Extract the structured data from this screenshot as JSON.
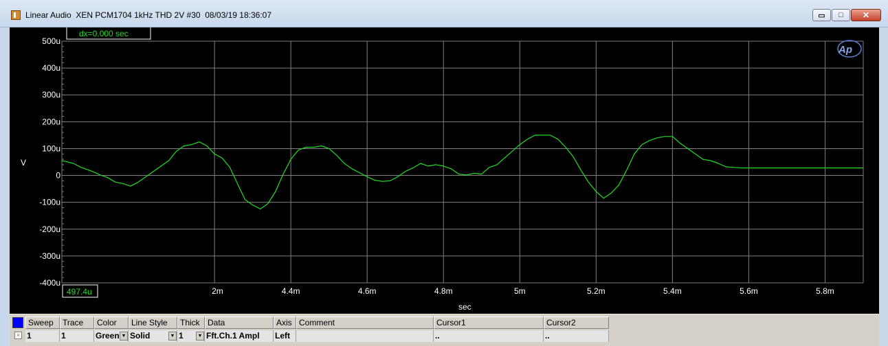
{
  "window": {
    "title": "Linear Audio  XEN PCM1704 1kHz THD 2V #30  08/03/19 18:36:07",
    "min_glyph": "▭",
    "max_glyph": "□",
    "close_glyph": "✕"
  },
  "readouts": {
    "dx": "dx=0.000   sec",
    "x_start": "497.4u"
  },
  "logo_text": "Ap",
  "chart_data": {
    "type": "line",
    "xlabel": "sec",
    "ylabel": "V",
    "xlim": [
      0.0038,
      0.0059
    ],
    "ylim": [
      -0.0004,
      0.0005
    ],
    "x_ticks": [
      {
        "value": 0.0042,
        "label": "2m"
      },
      {
        "value": 0.0044,
        "label": "4.4m"
      },
      {
        "value": 0.0046,
        "label": "4.6m"
      },
      {
        "value": 0.0048,
        "label": "4.8m"
      },
      {
        "value": 0.005,
        "label": "5m"
      },
      {
        "value": 0.0052,
        "label": "5.2m"
      },
      {
        "value": 0.0054,
        "label": "5.4m"
      },
      {
        "value": 0.0056,
        "label": "5.6m"
      },
      {
        "value": 0.0058,
        "label": "5.8m"
      }
    ],
    "y_ticks": [
      {
        "value": 0.0005,
        "label": "500u"
      },
      {
        "value": 0.0004,
        "label": "400u"
      },
      {
        "value": 0.0003,
        "label": "300u"
      },
      {
        "value": 0.0002,
        "label": "200u"
      },
      {
        "value": 0.0001,
        "label": "100u"
      },
      {
        "value": 0,
        "label": "0"
      },
      {
        "value": -0.0001,
        "label": "-100u"
      },
      {
        "value": -0.0002,
        "label": "-200u"
      },
      {
        "value": -0.0003,
        "label": "-300u"
      },
      {
        "value": -0.0004,
        "label": "-400u"
      }
    ],
    "grid": true,
    "colors": {
      "background": "#000000",
      "grid": "#808080",
      "trace": "#22dd22",
      "text": "#ffffff",
      "readout": "#22dd22"
    },
    "series": [
      {
        "x": [
          0.0038,
          0.00381,
          0.00383,
          0.00385,
          0.00388,
          0.0039,
          0.00392,
          0.00394,
          0.00396,
          0.00398,
          0.004,
          0.00402,
          0.00405,
          0.00408,
          0.0041,
          0.00412,
          0.00414,
          0.00416,
          0.00418,
          0.0042,
          0.00422,
          0.00424,
          0.00426,
          0.00428,
          0.0043,
          0.00432,
          0.00434,
          0.00436,
          0.00438,
          0.0044,
          0.00442,
          0.00444,
          0.00446,
          0.00448,
          0.0045,
          0.00452,
          0.00454,
          0.00456,
          0.00458,
          0.0046,
          0.00462,
          0.00464,
          0.00466,
          0.00468,
          0.0047,
          0.00472,
          0.00474,
          0.00476,
          0.00478,
          0.0048,
          0.00482,
          0.00484,
          0.00486,
          0.00488,
          0.0049,
          0.00492,
          0.00494,
          0.00496,
          0.00498,
          0.005,
          0.00502,
          0.00504,
          0.00506,
          0.00508,
          0.0051,
          0.00512,
          0.00514,
          0.00516,
          0.00518,
          0.0052,
          0.00522,
          0.00524,
          0.00526,
          0.00528,
          0.0053,
          0.00532,
          0.00534,
          0.00536,
          0.00538,
          0.0054,
          0.00542,
          0.00544,
          0.00546,
          0.00548,
          0.0055,
          0.00552,
          0.00554,
          0.00556,
          0.00558,
          0.0056,
          0.00562,
          0.00564,
          0.00566,
          0.00568,
          0.0057,
          0.00572,
          0.00574,
          0.00576,
          0.00578,
          0.0058,
          0.00582,
          0.00584,
          0.00586,
          0.00588,
          0.0059
        ],
        "y": [
          5.5e-05,
          5.2e-05,
          4.5e-05,
          3e-05,
          1.5e-05,
          2e-06,
          -8e-06,
          -2.5e-05,
          -3e-05,
          -4e-05,
          -2.5e-05,
          -5e-06,
          2.5e-05,
          5.5e-05,
          9e-05,
          0.00011,
          0.000115,
          0.000125,
          0.00011,
          8e-05,
          6.5e-05,
          3e-05,
          -3e-05,
          -9e-05,
          -0.00011,
          -0.000125,
          -0.000105,
          -6e-05,
          5e-06,
          6e-05,
          9.5e-05,
          0.000105,
          0.000105,
          0.00011,
          0.0001,
          7.5e-05,
          4.5e-05,
          2.5e-05,
          1e-05,
          -5e-06,
          -1.8e-05,
          -2.2e-05,
          -2e-05,
          -5e-06,
          1.5e-05,
          2.8e-05,
          4.5e-05,
          3.5e-05,
          4e-05,
          3.5e-05,
          2.5e-05,
          5e-06,
          2e-06,
          8e-06,
          5e-06,
          3e-05,
          4e-05,
          6.5e-05,
          9e-05,
          0.000115,
          0.000135,
          0.00015,
          0.00015,
          0.00015,
          0.000135,
          0.000105,
          7e-05,
          2e-05,
          -2.5e-05,
          -6e-05,
          -8.5e-05,
          -6.5e-05,
          -3.5e-05,
          2e-05,
          8e-05,
          0.000115,
          0.00013,
          0.00014,
          0.000145,
          0.000145,
          0.00012,
          0.0001,
          8e-05,
          6e-05,
          5.5e-05,
          4.5e-05,
          3.2e-05,
          3e-05,
          2.8e-05,
          2.8e-05,
          2.8e-05,
          2.8e-05,
          2.8e-05,
          2.8e-05,
          2.8e-05,
          2.8e-05,
          2.8e-05,
          2.8e-05,
          2.8e-05,
          2.8e-05,
          2.8e-05,
          2.8e-05,
          2.8e-05,
          2.8e-05,
          2.8e-05
        ]
      }
    ]
  },
  "table": {
    "headers": [
      "Sweep",
      "Trace",
      "Color",
      "Line Style",
      "Thick",
      "Data",
      "Axis",
      "Comment",
      "Cursor1",
      "Cursor2"
    ],
    "row": {
      "sweep": "1",
      "trace": "1",
      "color": "Green",
      "line_style": "Solid",
      "thick": "1",
      "data": "Fft.Ch.1 Ampl",
      "axis": "Left",
      "comment": "",
      "cursor1": "..",
      "cursor2": ".."
    },
    "checkbox_glyph": "×",
    "dropdown_glyph": "▼"
  }
}
